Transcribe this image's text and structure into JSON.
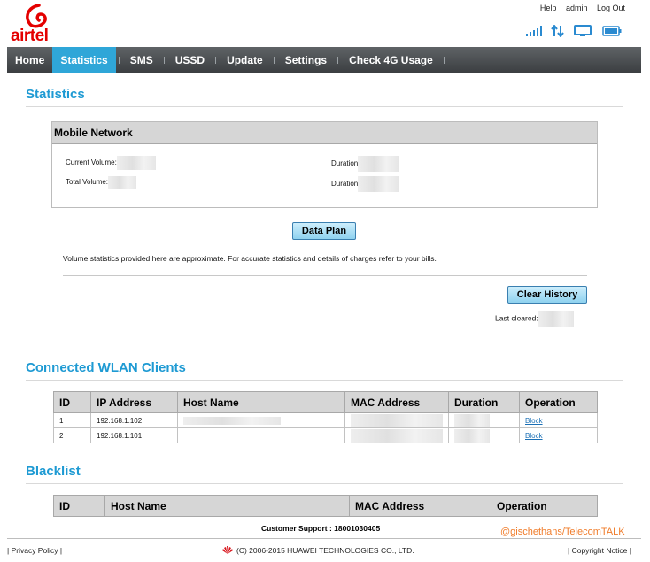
{
  "brand": {
    "name": "airtel",
    "color": "#e40000"
  },
  "top_links": {
    "help": "Help",
    "user": "admin",
    "logout": "Log Out"
  },
  "status_icons": [
    "signal-icon",
    "data-transfer-icon",
    "monitor-icon",
    "battery-icon"
  ],
  "nav": {
    "items": [
      "Home",
      "Statistics",
      "SMS",
      "USSD",
      "Update",
      "Settings",
      "Check 4G Usage"
    ],
    "active": "Statistics",
    "active_color": "#2fa6d8"
  },
  "statistics": {
    "title": "Statistics",
    "mobile_network": {
      "header": "Mobile Network",
      "current_volume_label": "Current Volume:",
      "total_volume_label": "Total Volume:",
      "duration_label_1": "Duration",
      "duration_label_2": "Duration"
    },
    "data_plan_button": "Data Plan",
    "note": "Volume statistics provided here are approximate. For accurate statistics and details of charges refer to your bills.",
    "clear_history_button": "Clear History",
    "last_cleared_label": "Last cleared:"
  },
  "wlan": {
    "title": "Connected WLAN Clients",
    "columns": [
      "ID",
      "IP Address",
      "Host Name",
      "MAC Address",
      "Duration",
      "Operation"
    ],
    "rows": [
      {
        "id": "1",
        "ip": "192.168.1.102",
        "op": "Block"
      },
      {
        "id": "2",
        "ip": "192.168.1.101",
        "op": "Block"
      }
    ]
  },
  "blacklist": {
    "title": "Blacklist",
    "columns": [
      "ID",
      "Host Name",
      "MAC Address",
      "Operation"
    ]
  },
  "support": "Customer Support : 18001030405",
  "watermark": "@gischethans/TelecomTALK",
  "footer": {
    "privacy": "Privacy Policy",
    "copyright": "(C) 2006-2015 HUAWEI TECHNOLOGIES CO., LTD.",
    "copyright_notice": "Copyright Notice"
  }
}
